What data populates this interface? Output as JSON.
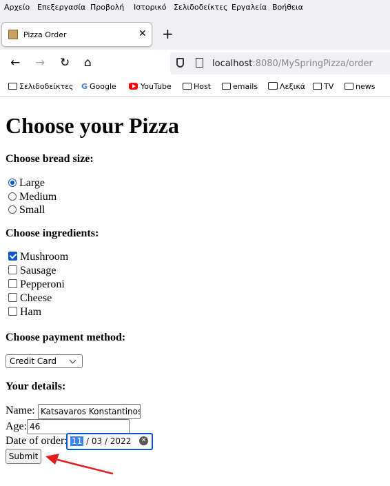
{
  "menu": [
    "Αρχείο",
    "Επεξεργασία",
    "Προβολή",
    "Ιστορικό",
    "Σελιδοδείκτες",
    "Εργαλεία",
    "Βοήθεια"
  ],
  "tab": {
    "title": "Pizza Order",
    "close": "✕"
  },
  "new_tab": "+",
  "nav": {
    "back": "←",
    "forward": "→",
    "reload": "↻",
    "home": "⌂"
  },
  "url": {
    "host": "localhost",
    "rest": ":8080/MySpringPizza/order"
  },
  "bookmarks": [
    "Σελιδοδείκτες",
    "Google",
    "YouTube",
    "Host",
    "emails",
    "Λεξικά",
    "TV",
    "news"
  ],
  "page": {
    "title": "Choose your Pizza",
    "bread_heading": "Choose bread size:",
    "bread_options": [
      "Large",
      "Medium",
      "Small"
    ],
    "bread_selected": "Large",
    "ingredients_heading": "Choose ingredients:",
    "ingredients": [
      "Mushroom",
      "Sausage",
      "Pepperoni",
      "Cheese",
      "Ham"
    ],
    "ingredients_checked": [
      "Mushroom"
    ],
    "payment_heading": "Choose payment method:",
    "payment_selected": "Credit Card",
    "details_heading": "Your details:",
    "name_label": "Name:",
    "name_value": "Katsavaros Konstantinos",
    "age_label": "Age:",
    "age_value": "46",
    "date_label": "Date of order:",
    "date_day": "11",
    "date_rest": "/ 03 / 2022",
    "submit_label": "Submit"
  },
  "annotation_arrow_color": "#e02020"
}
